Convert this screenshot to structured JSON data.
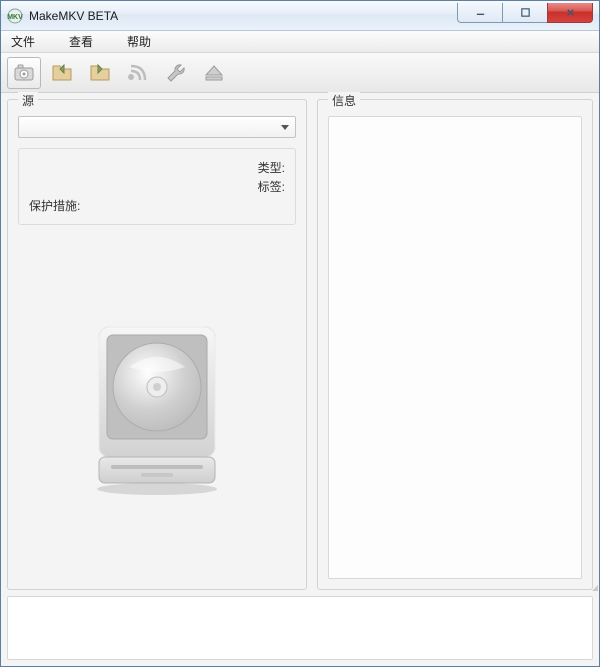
{
  "window": {
    "title": "MakeMKV BETA"
  },
  "menu": {
    "file": "文件",
    "view": "查看",
    "help": "帮助"
  },
  "toolbar": {
    "open_icon": "camera-icon",
    "folder_in_icon": "folder-in-icon",
    "folder_out_icon": "folder-out-icon",
    "stream_icon": "stream-icon",
    "settings_icon": "wrench-icon",
    "eject_icon": "eject-icon"
  },
  "source": {
    "legend": "源",
    "type_label": "类型:",
    "tag_label": "标签:",
    "protection_label": "保护措施:",
    "type_value": "",
    "tag_value": "",
    "protection_value": ""
  },
  "info": {
    "legend": "信息"
  }
}
